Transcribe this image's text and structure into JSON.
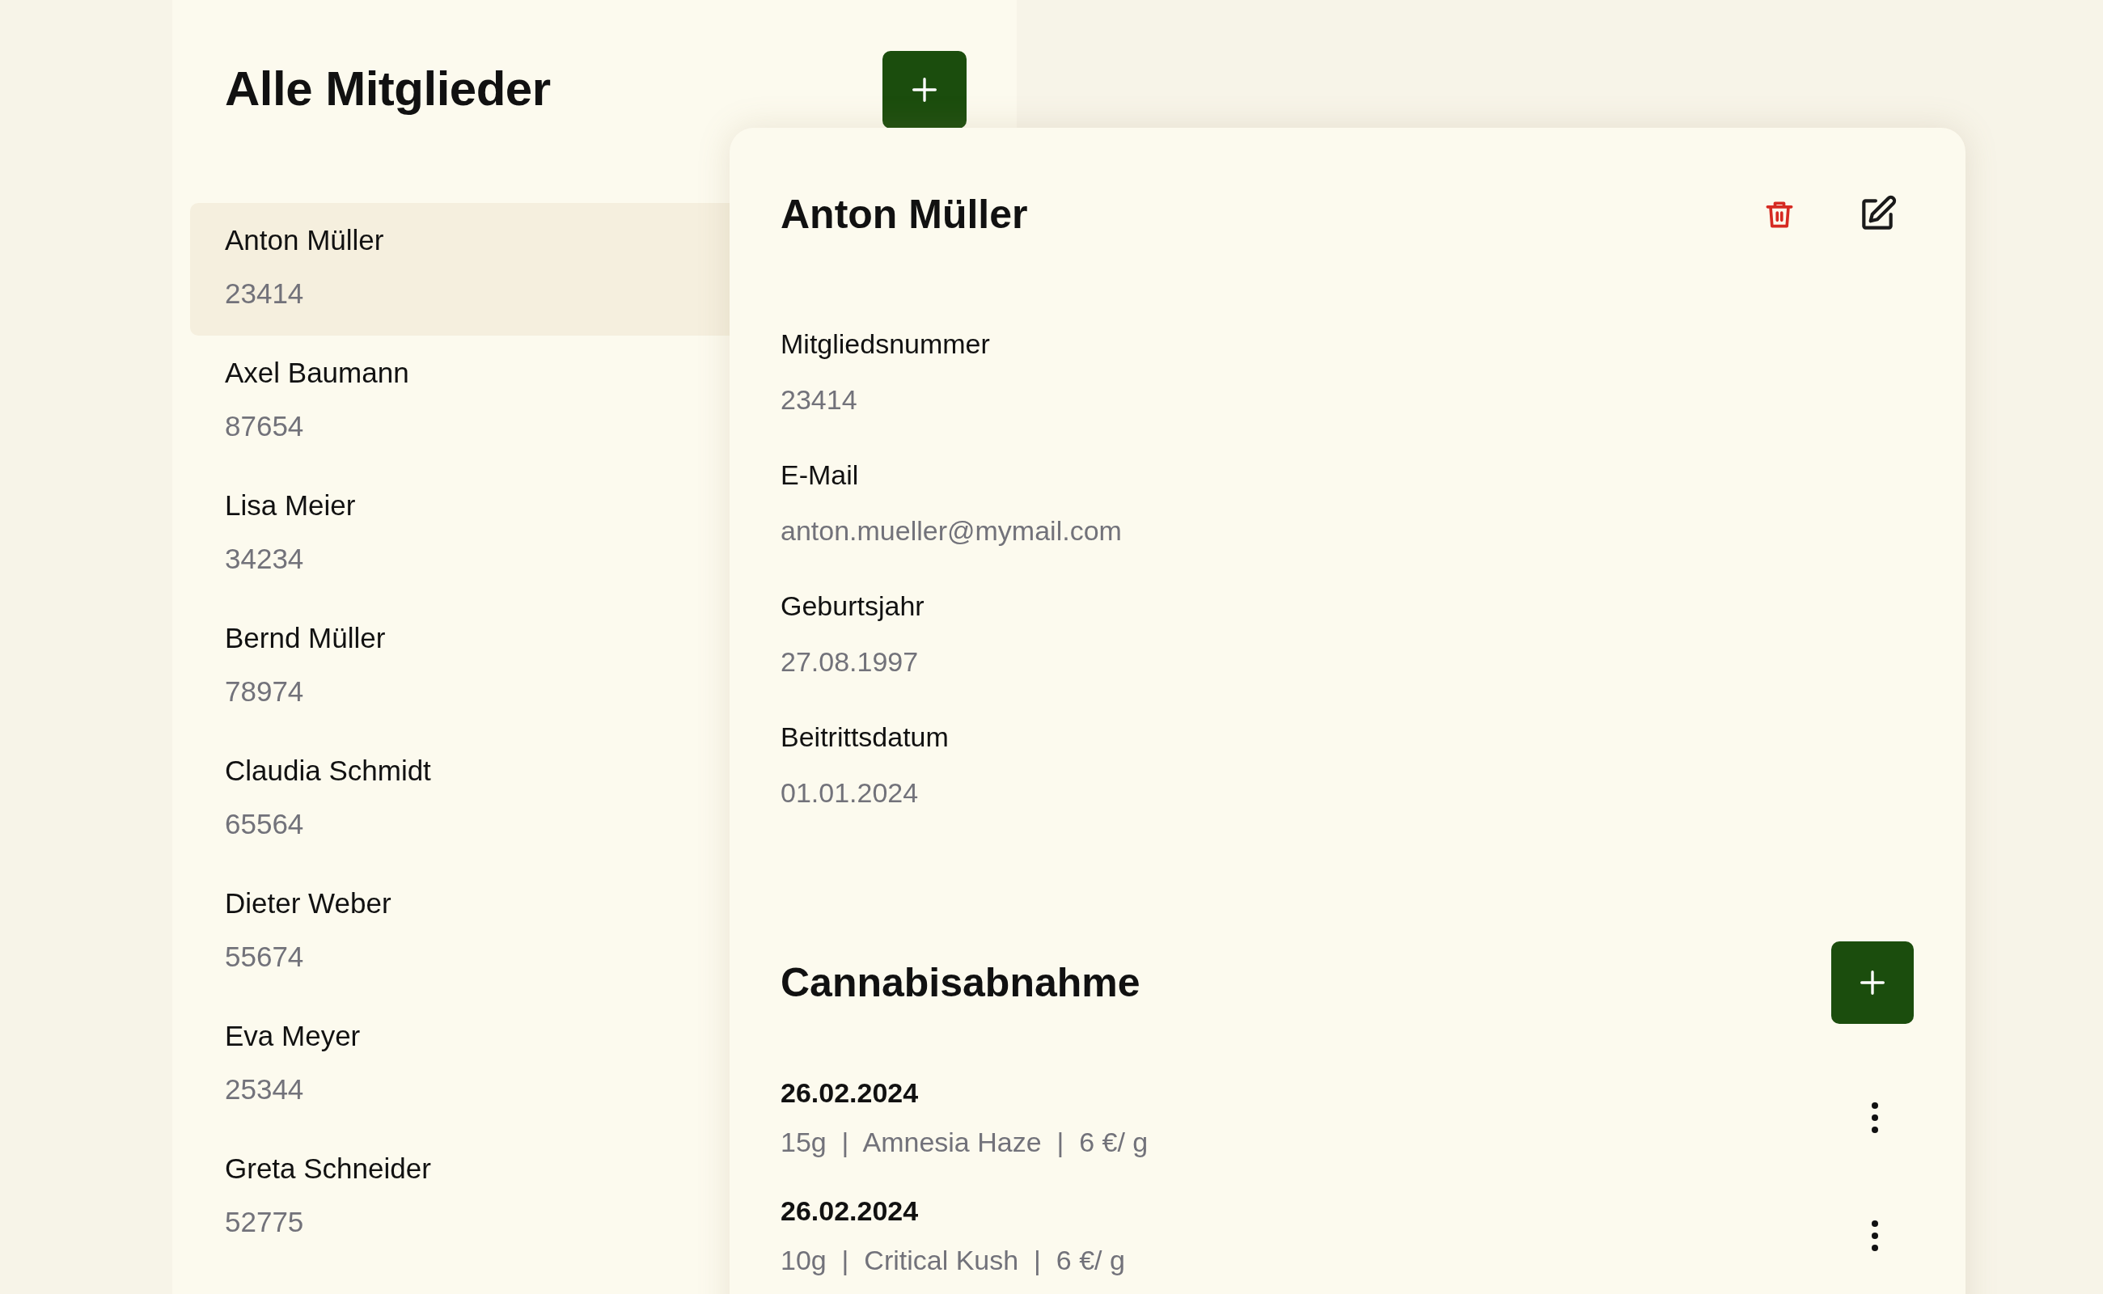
{
  "member_list": {
    "title": "Alle Mitglieder",
    "members": [
      {
        "name": "Anton Müller",
        "number": "23414",
        "selected": true
      },
      {
        "name": "Axel Baumann",
        "number": "87654",
        "selected": false
      },
      {
        "name": "Lisa Meier",
        "number": "34234",
        "selected": false
      },
      {
        "name": "Bernd Müller",
        "number": "78974",
        "selected": false
      },
      {
        "name": "Claudia Schmidt",
        "number": "65564",
        "selected": false
      },
      {
        "name": "Dieter Weber",
        "number": "55674",
        "selected": false
      },
      {
        "name": "Eva Meyer",
        "number": "25344",
        "selected": false
      },
      {
        "name": "Greta Schneider",
        "number": "52775",
        "selected": false
      }
    ]
  },
  "detail": {
    "name": "Anton Müller",
    "fields": [
      {
        "label": "Mitgliedsnummer",
        "value": "23414"
      },
      {
        "label": "E-Mail",
        "value": "anton.mueller@mymail.com"
      },
      {
        "label": "Geburtsjahr",
        "value": "27.08.1997"
      },
      {
        "label": "Beitrittsdatum",
        "value": "01.01.2024"
      }
    ],
    "purchases": {
      "title": "Cannabisabnahme",
      "entries": [
        {
          "date": "26.02.2024",
          "details": "15g  |  Amnesia Haze  |  6 €/ g"
        },
        {
          "date": "26.02.2024",
          "details": "10g  |  Critical Kush  |  6 €/ g"
        }
      ]
    }
  }
}
